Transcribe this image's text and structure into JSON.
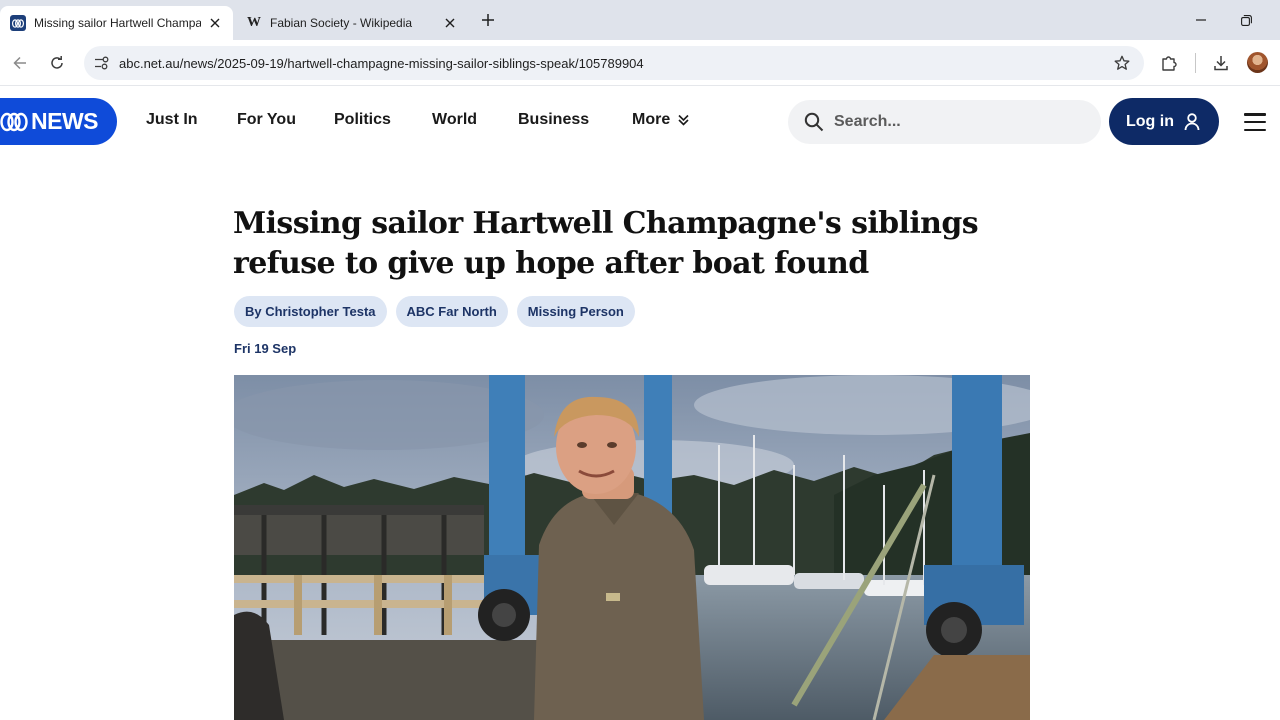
{
  "browser": {
    "tabs": [
      {
        "title": "Missing sailor Hartwell Champagne's siblings",
        "active": true,
        "favicon": "abc-news-favicon"
      },
      {
        "title": "Fabian Society - Wikipedia",
        "active": false,
        "favicon": "wikipedia-favicon",
        "favicon_letter": "W"
      }
    ],
    "url": "abc.net.au/news/2025-09-19/hartwell-champagne-missing-sailor-siblings-speak/105789904"
  },
  "site": {
    "logo_text": "NEWS",
    "nav": [
      "Just In",
      "For You",
      "Politics",
      "World",
      "Business",
      "More"
    ],
    "search_placeholder": "Search...",
    "login_label": "Log in",
    "colors": {
      "brand_blue": "#0f4bd9",
      "login_navy": "#0e2a66",
      "tag_bg": "#dde6f4",
      "tag_text": "#1d3466"
    }
  },
  "article": {
    "headline": "Missing sailor Hartwell Champagne's siblings refuse to give up hope after boat found",
    "tags": [
      "By Christopher Testa",
      "ABC Far North",
      "Missing Person"
    ],
    "date": "Fri 19 Sep",
    "hero_image": "Man in brown fleece jacket standing on a marina dock with blue boat lift and sailboats"
  }
}
